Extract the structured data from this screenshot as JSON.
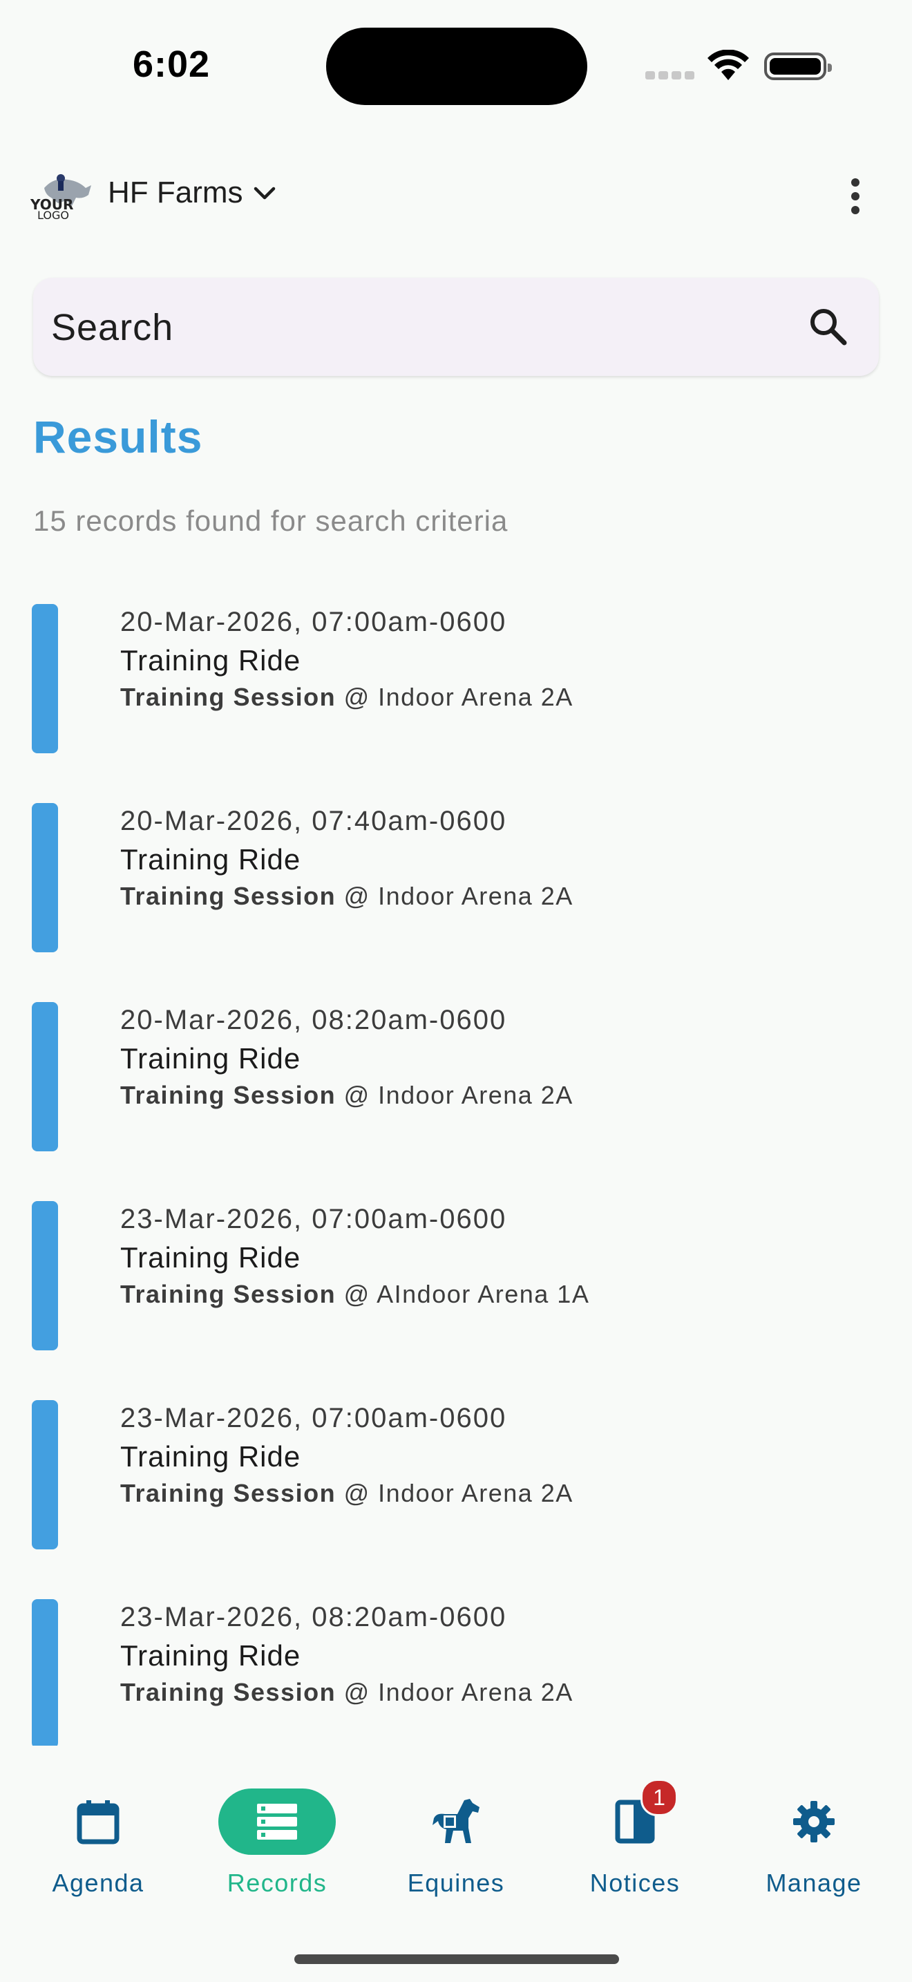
{
  "status": {
    "time": "6:02"
  },
  "header": {
    "org_name": "HF Farms",
    "logo_text_top": "YOUR",
    "logo_text_bottom": "LOGO"
  },
  "search": {
    "placeholder": "Search"
  },
  "results": {
    "title": "Results",
    "summary": "15 records found for search criteria"
  },
  "records": [
    {
      "datetime": "20-Mar-2026, 07:00am-0600",
      "title": "Training Ride",
      "type": "Training Session",
      "location": " @ Indoor Arena 2A"
    },
    {
      "datetime": "20-Mar-2026, 07:40am-0600",
      "title": "Training Ride",
      "type": "Training Session",
      "location": " @ Indoor Arena 2A"
    },
    {
      "datetime": "20-Mar-2026, 08:20am-0600",
      "title": "Training Ride",
      "type": "Training Session",
      "location": " @ Indoor Arena 2A"
    },
    {
      "datetime": "23-Mar-2026, 07:00am-0600",
      "title": "Training Ride",
      "type": "Training Session",
      "location": " @ AIndoor Arena 1A"
    },
    {
      "datetime": "23-Mar-2026, 07:00am-0600",
      "title": "Training Ride",
      "type": "Training Session",
      "location": " @ Indoor Arena 2A"
    },
    {
      "datetime": "23-Mar-2026, 08:20am-0600",
      "title": "Training Ride",
      "type": "Training Session",
      "location": " @ Indoor Arena 2A"
    }
  ],
  "nav": {
    "agenda": "Agenda",
    "records": "Records",
    "equines": "Equines",
    "notices": "Notices",
    "notices_badge": "1",
    "manage": "Manage",
    "active": "Records"
  },
  "colors": {
    "accent": "#3a9ad9",
    "record_bar": "#439fe0",
    "active_nav": "#21b68a",
    "nav_text": "#0f5c8c",
    "badge": "#c62828"
  }
}
